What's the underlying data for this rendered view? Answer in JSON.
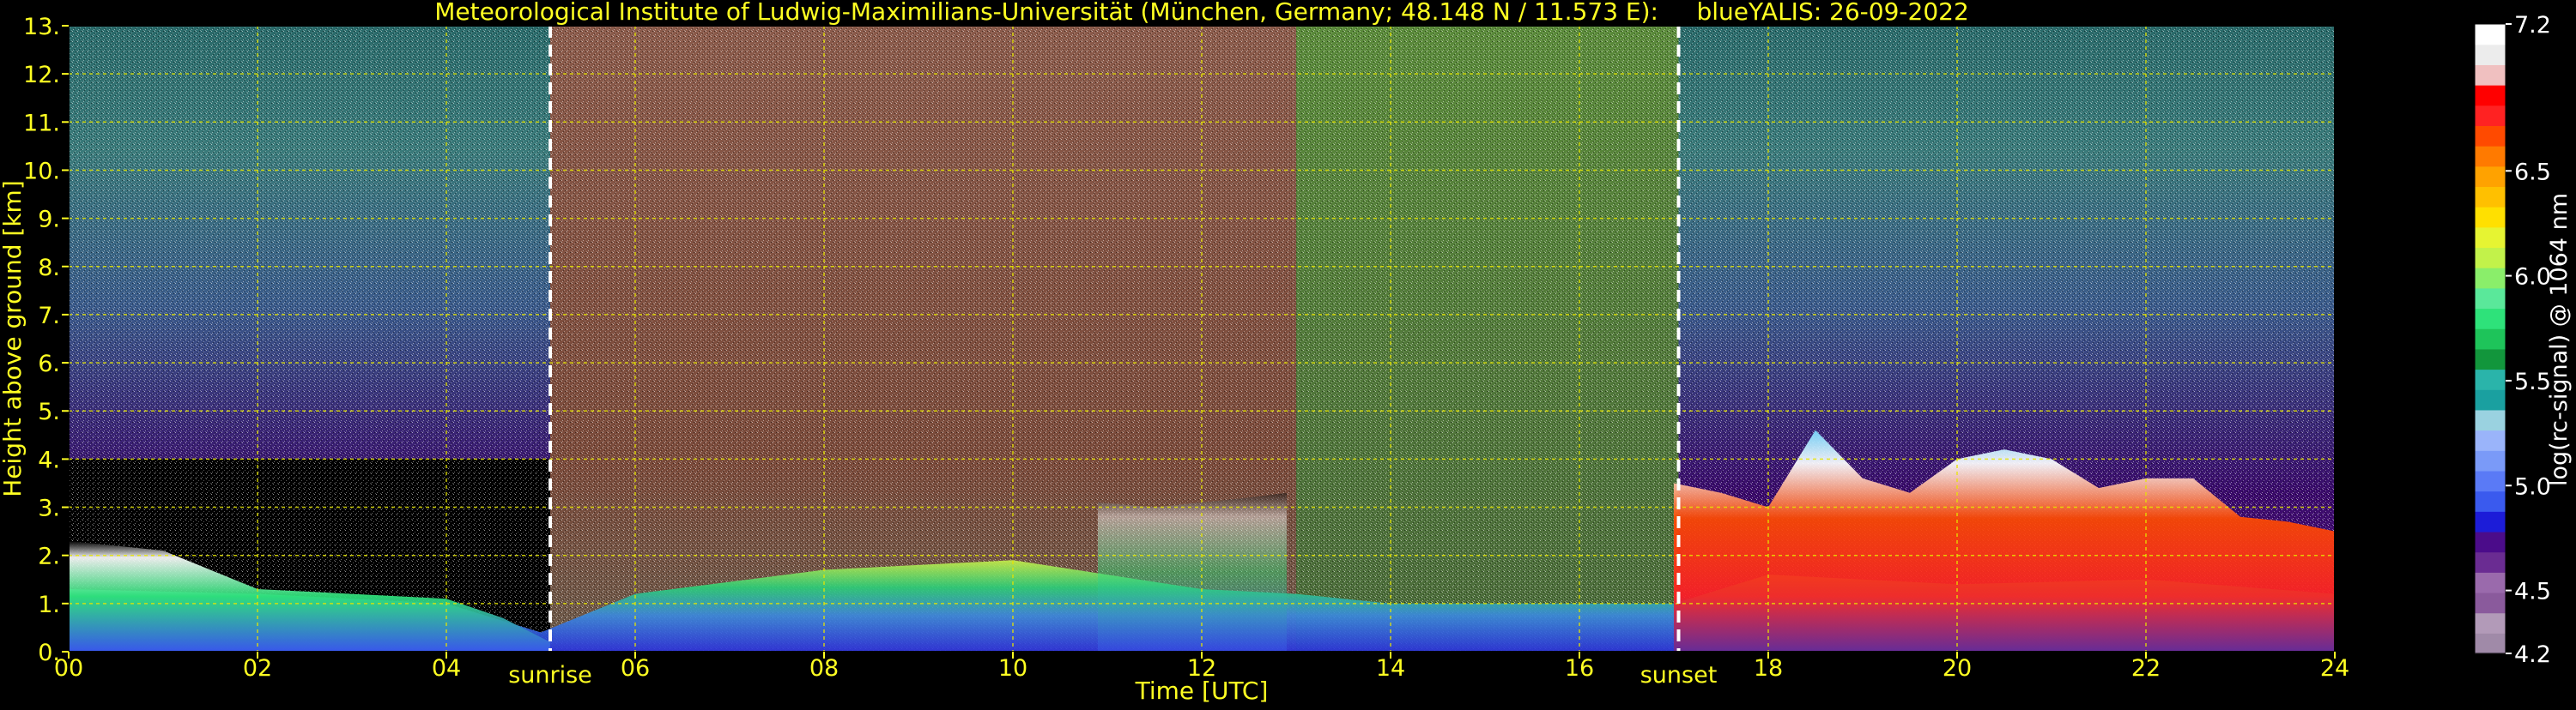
{
  "chart_data": {
    "type": "heatmap",
    "title": "Meteorological Institute of Ludwig-Maximilians-Universität (München, Germany; 48.148 N / 11.573 E):     blueYALIS: 26-09-2022",
    "xlabel": "Time [UTC]",
    "ylabel": "Height above ground [km]",
    "xlim": [
      0,
      24
    ],
    "ylim": [
      0,
      13
    ],
    "x_ticks": [
      0,
      2,
      4,
      6,
      8,
      10,
      12,
      14,
      16,
      18,
      20,
      22,
      24
    ],
    "x_tick_labels": [
      "00",
      "02",
      "04",
      "06",
      "08",
      "10",
      "12",
      "14",
      "16",
      "18",
      "20",
      "22",
      "24"
    ],
    "y_ticks": [
      0,
      1,
      2,
      3,
      4,
      5,
      6,
      7,
      8,
      9,
      10,
      11,
      12,
      13
    ],
    "y_tick_labels": [
      "0.",
      "1.",
      "2.",
      "3.",
      "4.",
      "5.",
      "6.",
      "7.",
      "8.",
      "9.",
      "10.",
      "11.",
      "12.",
      "13."
    ],
    "grid": true,
    "annotations": [
      {
        "label": "sunrise",
        "time": 5.1
      },
      {
        "label": "sunset",
        "time": 17.05
      }
    ],
    "colorbar": {
      "label": "log(rc-signal) @ 1064 nm",
      "range": [
        4.2,
        7.2
      ],
      "tick_values": [
        4.2,
        4.5,
        5.0,
        5.5,
        6.0,
        6.5,
        7.2
      ],
      "tick_labels": [
        "4.2",
        "4.5",
        "5.0",
        "5.5",
        "6.0",
        "6.5",
        "7.2"
      ],
      "colors": [
        "#a08aa8",
        "#b29ab8",
        "#8a5a9c",
        "#9a6aac",
        "#6a2c92",
        "#4b0c8a",
        "#1c1cd8",
        "#3a5aee",
        "#5a7af6",
        "#7a9af8",
        "#9ab4fa",
        "#9ad2e0",
        "#1aa0a0",
        "#2ab4aa",
        "#12963c",
        "#1ec45a",
        "#2ee27a",
        "#5ae89a",
        "#8aee6a",
        "#c2f24a",
        "#e6f432",
        "#ffe000",
        "#ffc000",
        "#ffa200",
        "#ff7a00",
        "#ff4a00",
        "#ff2222",
        "#ff0000",
        "#f0c0c0",
        "#ececec",
        "#ffffff"
      ]
    },
    "cloud_layers": [
      {
        "time": [
          0,
          1,
          2,
          3,
          4,
          4.6,
          5.1
        ],
        "top_km": [
          2.3,
          2.1,
          1.3,
          1.2,
          1.1,
          0.7,
          0.2
        ]
      },
      {
        "time": [
          10.9,
          11.5,
          12.0,
          12.5,
          12.9
        ],
        "top_km": [
          3.1,
          3.0,
          3.1,
          3.2,
          3.3
        ]
      },
      {
        "time": [
          17.0,
          17.5,
          18.0,
          18.5,
          19.0,
          19.5,
          20.0,
          20.5,
          21.0,
          21.5,
          22.0,
          22.5,
          23.0,
          23.5,
          24.0
        ],
        "top_km": [
          3.5,
          3.3,
          3.0,
          4.6,
          3.6,
          3.3,
          4.0,
          4.2,
          4.0,
          3.4,
          3.6,
          3.6,
          2.8,
          2.7,
          2.5
        ]
      }
    ],
    "boundary_layer_top_km": {
      "time": [
        0,
        2,
        4,
        5,
        6,
        8,
        10,
        12,
        13,
        14,
        16,
        17,
        18,
        20,
        22,
        24
      ],
      "values": [
        1.3,
        1.2,
        1.0,
        0.4,
        1.2,
        1.7,
        1.9,
        1.3,
        1.2,
        1.0,
        1.0,
        1.0,
        1.6,
        1.4,
        1.5,
        1.2
      ]
    }
  }
}
